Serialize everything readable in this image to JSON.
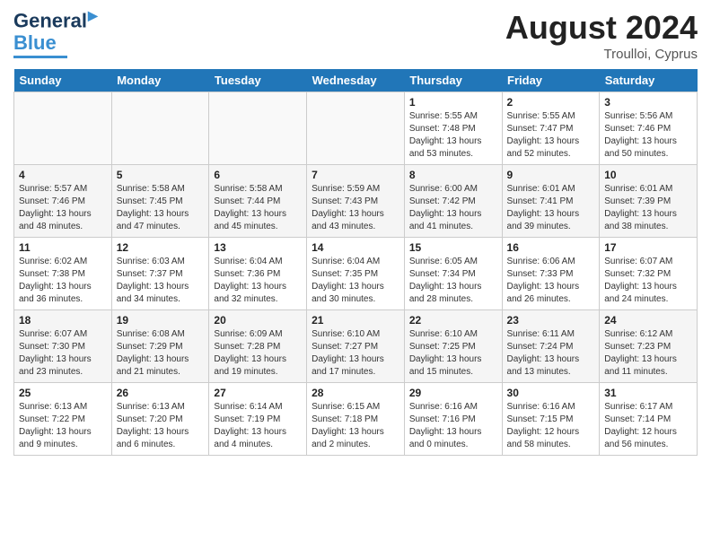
{
  "header": {
    "logo_general": "General",
    "logo_blue": "Blue",
    "main_title": "August 2024",
    "subtitle": "Troulloi, Cyprus"
  },
  "weekdays": [
    "Sunday",
    "Monday",
    "Tuesday",
    "Wednesday",
    "Thursday",
    "Friday",
    "Saturday"
  ],
  "weeks": [
    [
      {
        "day": "",
        "info": ""
      },
      {
        "day": "",
        "info": ""
      },
      {
        "day": "",
        "info": ""
      },
      {
        "day": "",
        "info": ""
      },
      {
        "day": "1",
        "info": "Sunrise: 5:55 AM\nSunset: 7:48 PM\nDaylight: 13 hours\nand 53 minutes."
      },
      {
        "day": "2",
        "info": "Sunrise: 5:55 AM\nSunset: 7:47 PM\nDaylight: 13 hours\nand 52 minutes."
      },
      {
        "day": "3",
        "info": "Sunrise: 5:56 AM\nSunset: 7:46 PM\nDaylight: 13 hours\nand 50 minutes."
      }
    ],
    [
      {
        "day": "4",
        "info": "Sunrise: 5:57 AM\nSunset: 7:46 PM\nDaylight: 13 hours\nand 48 minutes."
      },
      {
        "day": "5",
        "info": "Sunrise: 5:58 AM\nSunset: 7:45 PM\nDaylight: 13 hours\nand 47 minutes."
      },
      {
        "day": "6",
        "info": "Sunrise: 5:58 AM\nSunset: 7:44 PM\nDaylight: 13 hours\nand 45 minutes."
      },
      {
        "day": "7",
        "info": "Sunrise: 5:59 AM\nSunset: 7:43 PM\nDaylight: 13 hours\nand 43 minutes."
      },
      {
        "day": "8",
        "info": "Sunrise: 6:00 AM\nSunset: 7:42 PM\nDaylight: 13 hours\nand 41 minutes."
      },
      {
        "day": "9",
        "info": "Sunrise: 6:01 AM\nSunset: 7:41 PM\nDaylight: 13 hours\nand 39 minutes."
      },
      {
        "day": "10",
        "info": "Sunrise: 6:01 AM\nSunset: 7:39 PM\nDaylight: 13 hours\nand 38 minutes."
      }
    ],
    [
      {
        "day": "11",
        "info": "Sunrise: 6:02 AM\nSunset: 7:38 PM\nDaylight: 13 hours\nand 36 minutes."
      },
      {
        "day": "12",
        "info": "Sunrise: 6:03 AM\nSunset: 7:37 PM\nDaylight: 13 hours\nand 34 minutes."
      },
      {
        "day": "13",
        "info": "Sunrise: 6:04 AM\nSunset: 7:36 PM\nDaylight: 13 hours\nand 32 minutes."
      },
      {
        "day": "14",
        "info": "Sunrise: 6:04 AM\nSunset: 7:35 PM\nDaylight: 13 hours\nand 30 minutes."
      },
      {
        "day": "15",
        "info": "Sunrise: 6:05 AM\nSunset: 7:34 PM\nDaylight: 13 hours\nand 28 minutes."
      },
      {
        "day": "16",
        "info": "Sunrise: 6:06 AM\nSunset: 7:33 PM\nDaylight: 13 hours\nand 26 minutes."
      },
      {
        "day": "17",
        "info": "Sunrise: 6:07 AM\nSunset: 7:32 PM\nDaylight: 13 hours\nand 24 minutes."
      }
    ],
    [
      {
        "day": "18",
        "info": "Sunrise: 6:07 AM\nSunset: 7:30 PM\nDaylight: 13 hours\nand 23 minutes."
      },
      {
        "day": "19",
        "info": "Sunrise: 6:08 AM\nSunset: 7:29 PM\nDaylight: 13 hours\nand 21 minutes."
      },
      {
        "day": "20",
        "info": "Sunrise: 6:09 AM\nSunset: 7:28 PM\nDaylight: 13 hours\nand 19 minutes."
      },
      {
        "day": "21",
        "info": "Sunrise: 6:10 AM\nSunset: 7:27 PM\nDaylight: 13 hours\nand 17 minutes."
      },
      {
        "day": "22",
        "info": "Sunrise: 6:10 AM\nSunset: 7:25 PM\nDaylight: 13 hours\nand 15 minutes."
      },
      {
        "day": "23",
        "info": "Sunrise: 6:11 AM\nSunset: 7:24 PM\nDaylight: 13 hours\nand 13 minutes."
      },
      {
        "day": "24",
        "info": "Sunrise: 6:12 AM\nSunset: 7:23 PM\nDaylight: 13 hours\nand 11 minutes."
      }
    ],
    [
      {
        "day": "25",
        "info": "Sunrise: 6:13 AM\nSunset: 7:22 PM\nDaylight: 13 hours\nand 9 minutes."
      },
      {
        "day": "26",
        "info": "Sunrise: 6:13 AM\nSunset: 7:20 PM\nDaylight: 13 hours\nand 6 minutes."
      },
      {
        "day": "27",
        "info": "Sunrise: 6:14 AM\nSunset: 7:19 PM\nDaylight: 13 hours\nand 4 minutes."
      },
      {
        "day": "28",
        "info": "Sunrise: 6:15 AM\nSunset: 7:18 PM\nDaylight: 13 hours\nand 2 minutes."
      },
      {
        "day": "29",
        "info": "Sunrise: 6:16 AM\nSunset: 7:16 PM\nDaylight: 13 hours\nand 0 minutes."
      },
      {
        "day": "30",
        "info": "Sunrise: 6:16 AM\nSunset: 7:15 PM\nDaylight: 12 hours\nand 58 minutes."
      },
      {
        "day": "31",
        "info": "Sunrise: 6:17 AM\nSunset: 7:14 PM\nDaylight: 12 hours\nand 56 minutes."
      }
    ]
  ]
}
